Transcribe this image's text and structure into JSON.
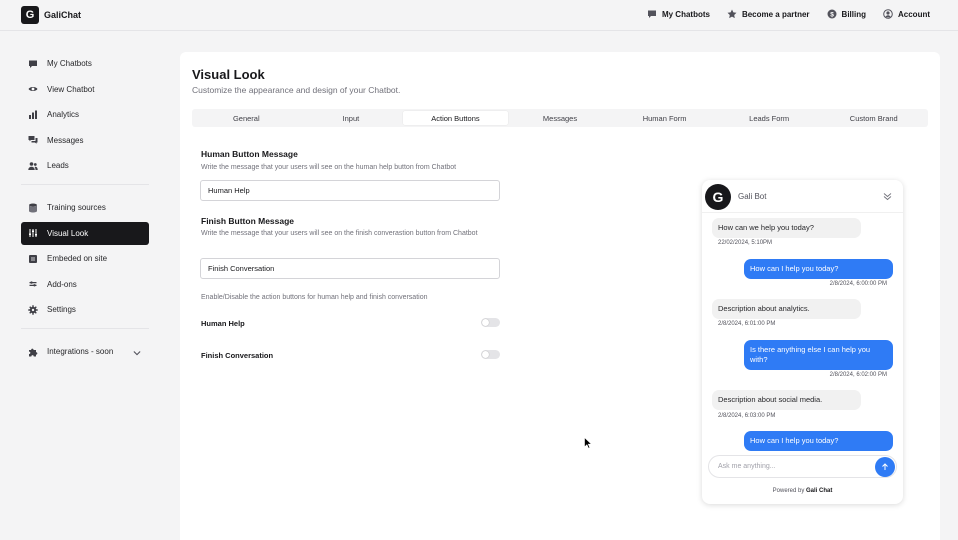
{
  "app": {
    "logo_letter": "G",
    "name": "GaliChat"
  },
  "topnav": [
    {
      "label": "My Chatbots",
      "icon": "chat-icon"
    },
    {
      "label": "Become a partner",
      "icon": "star-icon"
    },
    {
      "label": "Billing",
      "icon": "dollar-icon"
    },
    {
      "label": "Account",
      "icon": "user-icon"
    }
  ],
  "sidebar": {
    "items": [
      {
        "label": "My Chatbots",
        "icon": "chat-icon"
      },
      {
        "label": "View Chatbot",
        "icon": "eye-icon"
      },
      {
        "label": "Analytics",
        "icon": "bar-chart-icon"
      },
      {
        "label": "Messages",
        "icon": "messages-icon"
      },
      {
        "label": "Leads",
        "icon": "users-icon"
      },
      {
        "label": "Training sources",
        "icon": "database-icon"
      },
      {
        "label": "Visual Look",
        "icon": "sliders-icon",
        "active": true
      },
      {
        "label": "Embeded on site",
        "icon": "embed-icon"
      },
      {
        "label": "Add-ons",
        "icon": "addon-icon"
      },
      {
        "label": "Settings",
        "icon": "gear-icon"
      },
      {
        "label": "Integrations - soon",
        "icon": "puzzle-icon"
      }
    ]
  },
  "page": {
    "title": "Visual Look",
    "subtitle": "Customize the appearance and design of your Chatbot."
  },
  "tabs": [
    "General",
    "Input",
    "Action Buttons",
    "Messages",
    "Human Form",
    "Leads Form",
    "Custom Brand"
  ],
  "active_tab": "Action Buttons",
  "form": {
    "human_label": "Human Button Message",
    "human_desc": "Write the message that your users will see on the human help button from Chatbot",
    "human_value": "Human Help",
    "finish_label": "Finish Button Message",
    "finish_desc": "Write the message that your users will see on the finish converastion button from Chatbot",
    "finish_value": "Finish Conversation",
    "toggle_desc": "Enable/Disable the action buttons for human help and finish conversation",
    "toggle_human": "Human Help",
    "toggle_finish": "Finish Conversation"
  },
  "chat": {
    "avatar_letter": "G",
    "bot_name": "Gali Bot",
    "messages": [
      {
        "from": "bot",
        "text": "How can we help you today?",
        "time": "22/02/2024, 5:10PM"
      },
      {
        "from": "user",
        "text": "How can I help you today?",
        "time": "2/8/2024, 6:00:00 PM"
      },
      {
        "from": "bot",
        "text": "Description about analytics.",
        "time": "2/8/2024, 6:01:00 PM"
      },
      {
        "from": "user",
        "text": "Is there anything else I can help you with?",
        "time": "2/8/2024, 6:02:00 PM"
      },
      {
        "from": "bot",
        "text": "Description about social media.",
        "time": "2/8/2024, 6:03:00 PM"
      },
      {
        "from": "user",
        "text": "How can I help you today?",
        "time": ""
      }
    ],
    "input_placeholder": "Ask me anything...",
    "powered_prefix": "Powered by",
    "powered_brand": "Gali Chat"
  },
  "colors": {
    "accent": "#2f7bf5",
    "dark": "#18181b"
  }
}
